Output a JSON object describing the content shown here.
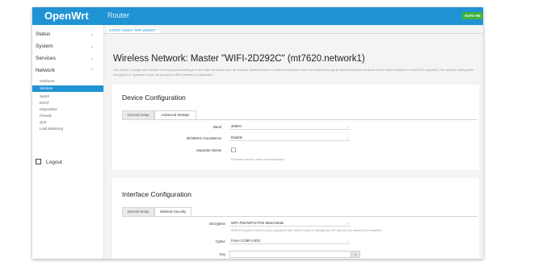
{
  "header": {
    "brand": "OpenWrt",
    "hostname": "Router",
    "badge": "AUTO RE"
  },
  "sidebar": {
    "items": [
      {
        "label": "Status"
      },
      {
        "label": "System"
      },
      {
        "label": "Services"
      },
      {
        "label": "Network"
      }
    ],
    "network_sub": [
      "Interfaces",
      "Wireless",
      "Switch",
      "DHCP",
      "Diagnostics",
      "Firewall",
      "QoS",
      "Load Balancing"
    ],
    "active_sub": "Wireless",
    "logout": "Logout"
  },
  "breadcrumb": {
    "tab": "mt7620: Master \"WiFi-2D292C\""
  },
  "page": {
    "title": "Wireless Network: Master \"WIFI-2D292C\" (mt7620.network1)",
    "description": "The Device Configuration section covers physical settings of the radio hardware such as channel, transmit power or antenna selection which are shared among all defined wireless networks (if the radio hardware is multi-SSID capable). Per network settings like encryption or operation mode are grouped in the Interface Configuration."
  },
  "device_config": {
    "title": "Device Configuration",
    "tabs": [
      "General Setup",
      "Advanced Settings"
    ],
    "active_tab": 1,
    "fields": [
      {
        "label": "Band",
        "value": "40MHz"
      },
      {
        "label": "20/40MHz Coexistence",
        "value": "Disable"
      }
    ],
    "separate_clients": {
      "label": "Separate Clients",
      "hint": "Prevents client-to-client communication"
    }
  },
  "interface_config": {
    "title": "Interface Configuration",
    "tabs": [
      "General Setup",
      "Wireless Security"
    ],
    "active_tab": 1,
    "encryption": {
      "label": "Encryption",
      "value": "WPA-PSK/WPA2-PSK Mixed Mode",
      "hint": "WPA-Encryption requires wpa_supplicant (for client mode) or hostapd (for AP and ad-hoc mode) to be installed."
    },
    "cipher": {
      "label": "Cipher",
      "value": "Force CCMP (AES)"
    },
    "key": {
      "label": "Key",
      "value": ""
    }
  },
  "colors": {
    "accent": "#1f93d3",
    "badge": "#3cb13c"
  }
}
